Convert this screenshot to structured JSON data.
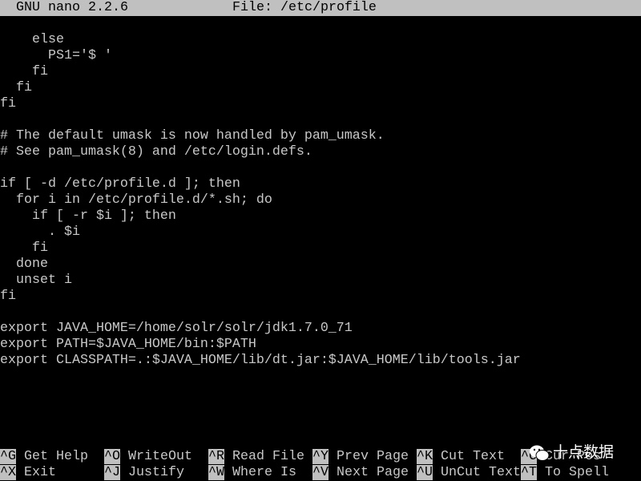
{
  "header": {
    "app_version": "GNU nano 2.2.6",
    "file_label": "File: /etc/profile"
  },
  "editor": {
    "lines": [
      "    else",
      "      PS1='$ '",
      "    fi",
      "  fi",
      "fi",
      "",
      "# The default umask is now handled by pam_umask.",
      "# See pam_umask(8) and /etc/login.defs.",
      "",
      "if [ -d /etc/profile.d ]; then",
      "  for i in /etc/profile.d/*.sh; do",
      "    if [ -r $i ]; then",
      "      . $i",
      "    fi",
      "  done",
      "  unset i",
      "fi",
      "",
      "export JAVA_HOME=/home/solr/solr/jdk1.7.0_71",
      "export PATH=$JAVA_HOME/bin:$PATH",
      "export CLASSPATH=.:$JAVA_HOME/lib/dt.jar:$JAVA_HOME/lib/tools.jar"
    ]
  },
  "shortcuts": {
    "row1": [
      {
        "key": "^G",
        "label": "Get Help"
      },
      {
        "key": "^O",
        "label": "WriteOut"
      },
      {
        "key": "^R",
        "label": "Read File"
      },
      {
        "key": "^Y",
        "label": "Prev Page"
      },
      {
        "key": "^K",
        "label": "Cut Text"
      },
      {
        "key": "^C",
        "label": "Cur Pos"
      }
    ],
    "row2": [
      {
        "key": "^X",
        "label": "Exit"
      },
      {
        "key": "^J",
        "label": "Justify"
      },
      {
        "key": "^W",
        "label": "Where Is"
      },
      {
        "key": "^V",
        "label": "Next Page"
      },
      {
        "key": "^U",
        "label": "UnCut Text"
      },
      {
        "key": "^T",
        "label": "To Spell"
      }
    ]
  },
  "watermark": {
    "text": "十点数据",
    "icon": "wechat-icon"
  },
  "colors": {
    "text": "#c8c8c8",
    "bar": "#c0c0c0",
    "background": "#000000"
  }
}
